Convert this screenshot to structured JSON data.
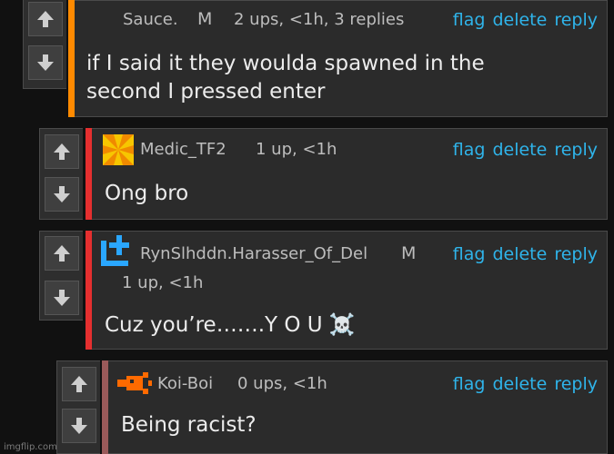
{
  "actions": {
    "flag": "flag",
    "delete": "delete",
    "reply": "reply"
  },
  "comments": [
    {
      "username": "Sauce.",
      "mod_badge": "M",
      "meta": "2 ups, <1h, 3 replies",
      "text_lines": [
        "if I said it they woulda spawned in the",
        "second I pressed enter"
      ],
      "bar_color": "#ff8a00",
      "avatar": null
    },
    {
      "username": "Medic_TF2",
      "mod_badge": "",
      "meta": "1 up, <1h",
      "text_lines": [
        "Ong bro"
      ],
      "bar_color": "#e52f2f",
      "avatar": "orange-yellow-sunburst-avatar"
    },
    {
      "username": "RynSlhddn.Harasser_Of_Del",
      "mod_badge": "M",
      "meta": "1 up, <1h",
      "text_lines": [
        "Cuz you’re…….Y O U ☠️"
      ],
      "bar_color": "#e52f2f",
      "avatar": "blue-plus-avatar"
    },
    {
      "username": "Koi-Boi",
      "mod_badge": "",
      "meta": "0 ups, <1h",
      "text_lines": [
        "Being racist?"
      ],
      "bar_color": "#9a5a5a",
      "avatar": "orange-pixel-avatar"
    }
  ],
  "watermark": "imgflip.com"
}
